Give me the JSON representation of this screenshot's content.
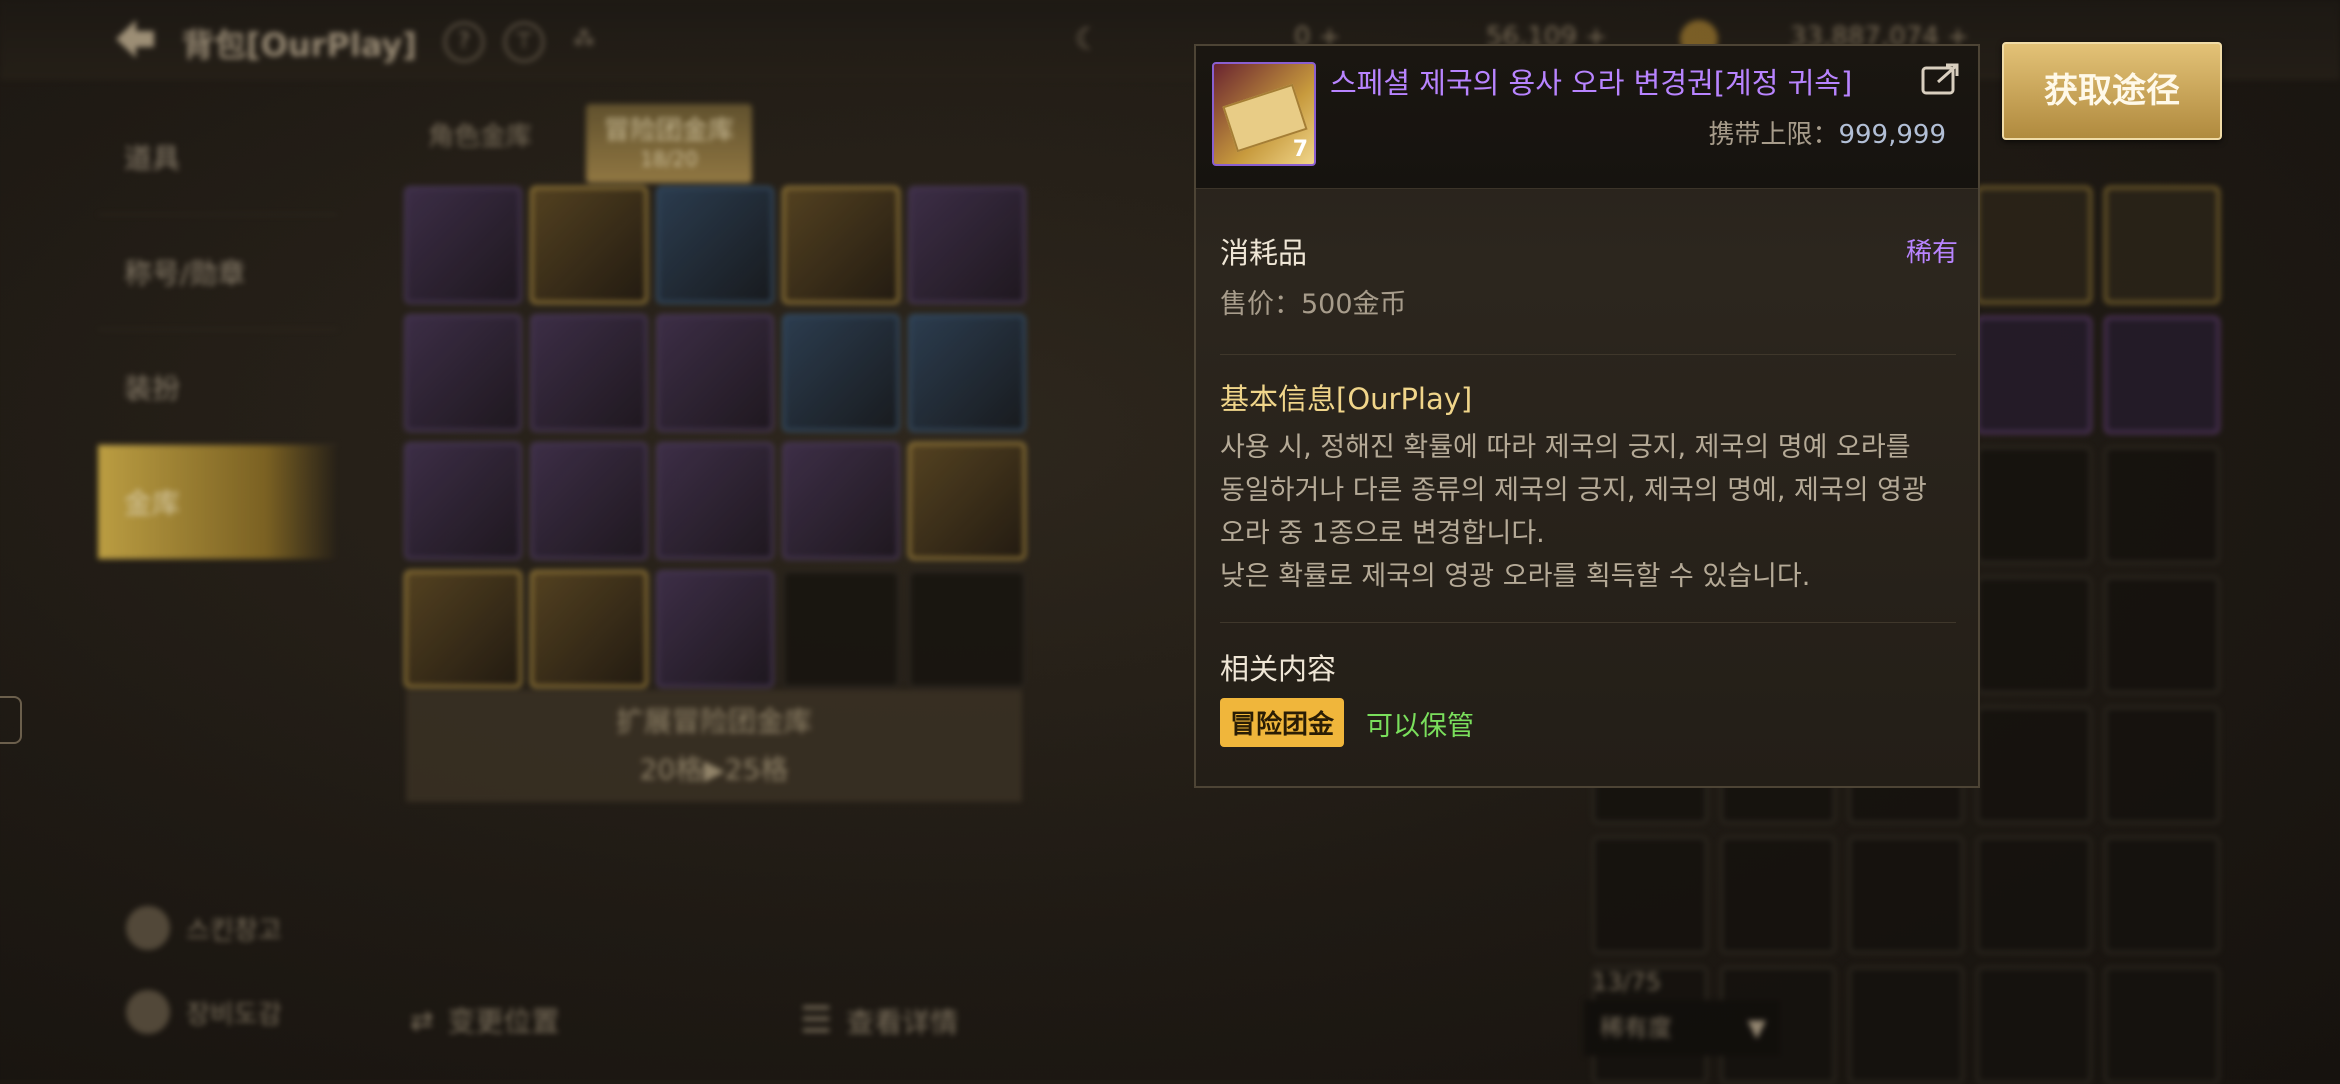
{
  "window": {
    "title": "背包[OurPlay]"
  },
  "sidebar": {
    "items": [
      {
        "label": "道具"
      },
      {
        "label": "称号/勋章"
      },
      {
        "label": "装扮"
      },
      {
        "label": "金库"
      }
    ],
    "bottom_items": [
      {
        "label": "스킨창고"
      },
      {
        "label": "장비도감"
      }
    ]
  },
  "tabs": [
    {
      "label": "角色金库"
    },
    {
      "label": "冒险团金库",
      "sub": "18/20"
    }
  ],
  "expand_button": {
    "line1": "扩展冒险团金库",
    "line2": "20格▶25格"
  },
  "bottom_actions": {
    "move": "变更位置",
    "detail": "查看详情"
  },
  "right_panel": {
    "count": "13/75",
    "sort_label": "稀有度"
  },
  "currencies": [
    {
      "value": "0 +"
    },
    {
      "value": "56,109 +"
    },
    {
      "value": "33,887,074 +"
    }
  ],
  "tooltip": {
    "item_name": "스페셜 제국의 용사 오라 변경권[계정 귀속]",
    "quantity": "7",
    "carry_limit_label": "携带上限：",
    "carry_limit_value": "999,999",
    "category": "消耗品",
    "rarity": "稀有",
    "price": "售价：500金币",
    "basic_info_title": "基本信息[OurPlay]",
    "description": [
      "사용 시, 정해진 확률에 따라 제국의 긍지, 제국의 명예 오라를",
      "동일하거나 다른 종류의 제국의 긍지, 제국의 명예, 제국의 영광",
      "오라 중 1종으로 변경합니다.",
      "낮은 확률로 제국의 영광 오라를 획득할 수 있습니다."
    ],
    "related_title": "相关内容",
    "badge": "冒险团金",
    "storable": "可以保管"
  },
  "get_button": {
    "label": "获取途径"
  }
}
